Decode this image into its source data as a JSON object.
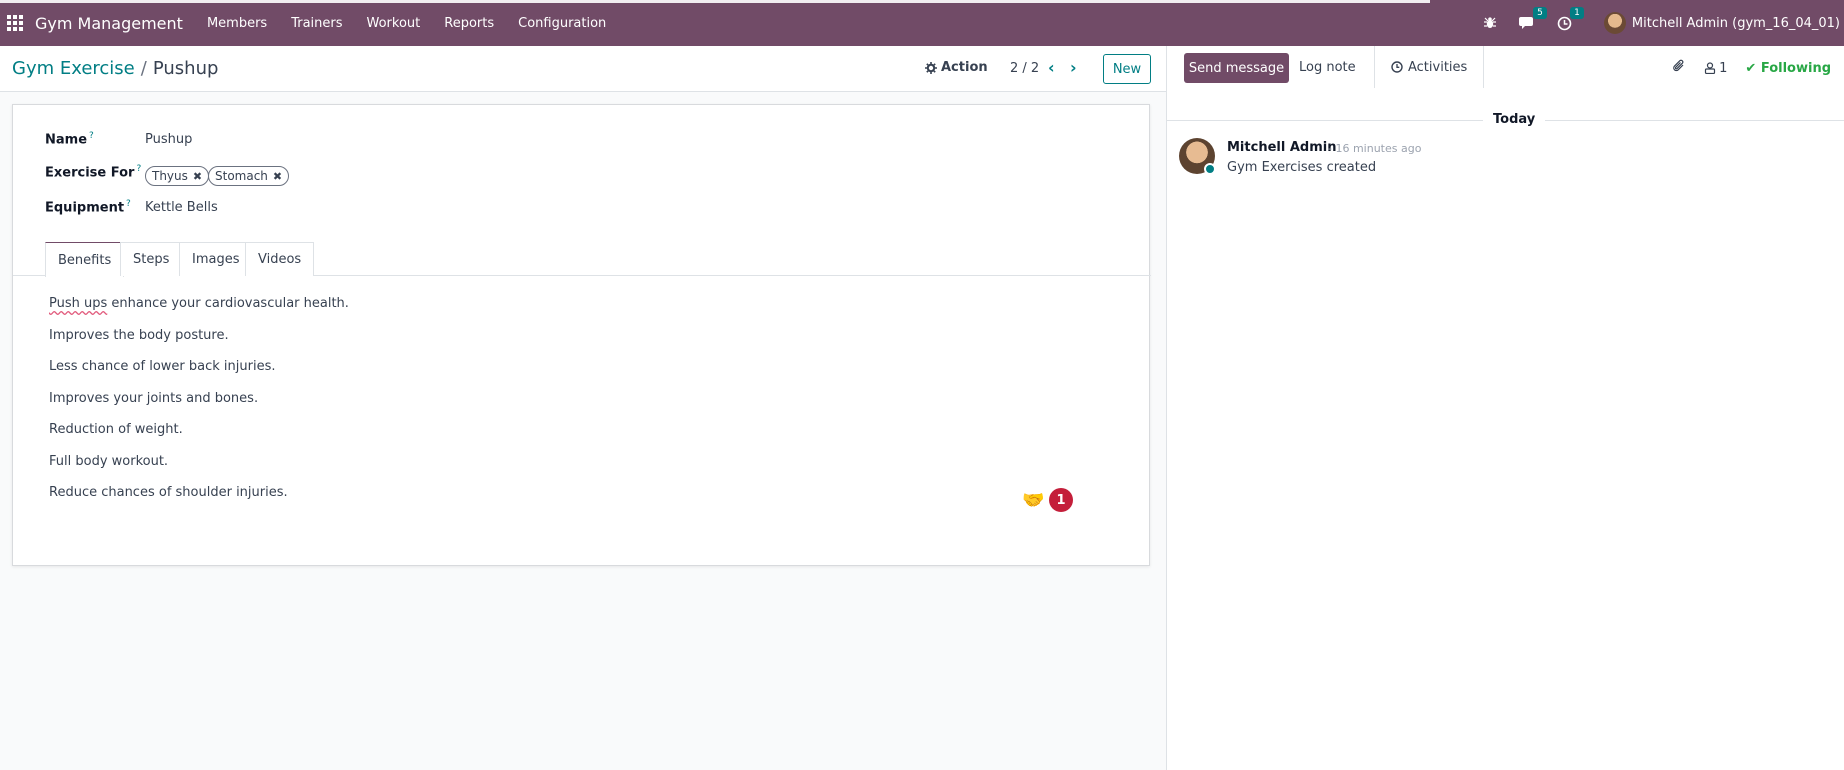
{
  "navbar": {
    "brand": "Gym Management",
    "menus": [
      "Members",
      "Trainers",
      "Workout",
      "Reports",
      "Configuration"
    ],
    "messages_count": "5",
    "activities_count": "1",
    "user": "Mitchell Admin (gym_16_04_01)"
  },
  "control": {
    "breadcrumb_parent": "Gym Exercise",
    "breadcrumb_current": "Pushup",
    "action_label": "Action",
    "pager": "2 / 2",
    "new_label": "New"
  },
  "form": {
    "name_label": "Name",
    "name_value": "Pushup",
    "exercise_for_label": "Exercise For",
    "tags": [
      "Thyus",
      "Stomach"
    ],
    "equipment_label": "Equipment",
    "equipment_value": "Kettle Bells",
    "tooltip_mark": "?",
    "tabs": [
      "Benefits",
      "Steps",
      "Images",
      "Videos"
    ],
    "benefits": {
      "first_underlined": "Push ups",
      "first_rest": " enhance your cardiovascular health.",
      "lines": [
        "Improves the body posture.",
        "Less chance of lower back injuries.",
        "Improves your joints and bones.",
        "Reduction of weight.",
        "Full body workout.",
        "Reduce chances of shoulder injuries."
      ]
    },
    "grammar_badge": "1"
  },
  "chatter": {
    "send_message": "Send message",
    "log_note": "Log note",
    "activities": "Activities",
    "followers_count": "1",
    "following": "Following",
    "date_separator": "Today",
    "message": {
      "author": "Mitchell Admin",
      "when": "- 16 minutes ago",
      "body": "Gym Exercises created"
    }
  },
  "colors": {
    "brand": "#714b67",
    "accent": "#017e84",
    "following": "#28a745",
    "badge_red": "#c41e3a"
  }
}
